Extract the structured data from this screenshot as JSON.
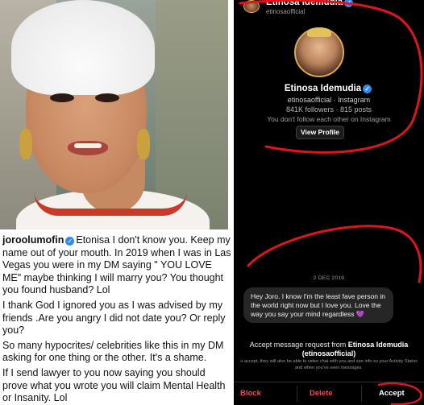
{
  "photo": {
    "subject": "woman-in-white-headwrap"
  },
  "comment": {
    "handle": "joroolumofin",
    "paragraphs": [
      "Etonisa I don't know you. Keep my name out of your mouth. In 2019 when I was in Las Vegas you were in my DM saying \" YOU LOVE ME\" maybe thinking I will marry you? You thought you found husband? Lol",
      "I thank God I ignored you as I was advised by my friends .Are you angry I did not date you? Or reply you?",
      "So many hypocrites/ celebrities like this in my DM asking for one thing or the other. It's a shame.",
      "If I send lawyer to you now saying you should prove what you wrote you will claim Mental Health or Insanity. Lol"
    ]
  },
  "phone": {
    "header": {
      "name": "Etinosa Idemudia",
      "username": "etinosaofficial"
    },
    "profile": {
      "name": "Etinosa Idemudia",
      "handle_line": "etinosaofficial · Instagram",
      "stats_line": "841K followers · 815 posts",
      "follow_line": "You don't follow each other on Instagram",
      "view_profile_label": "View Profile"
    },
    "date_separator": "2 DEC 2019",
    "message": {
      "text": "Hey Joro. I know I'm the least fave person in the world right now but I love you. Love the way you say your mind regardless",
      "emoji": "💜"
    },
    "request": {
      "prefix": "Accept message request from",
      "name": "Etinosa Idemudia",
      "username": "(etinosaofficial)",
      "description": "u accept, they will also be able to video chat with you and see info su your Activity Status and when you've seen messages."
    },
    "actions": {
      "block": "Block",
      "delete": "Delete",
      "accept": "Accept"
    },
    "colors": {
      "annotation_red": "#e0141e",
      "danger": "#ed4956",
      "verified": "#2f8bf0"
    }
  }
}
